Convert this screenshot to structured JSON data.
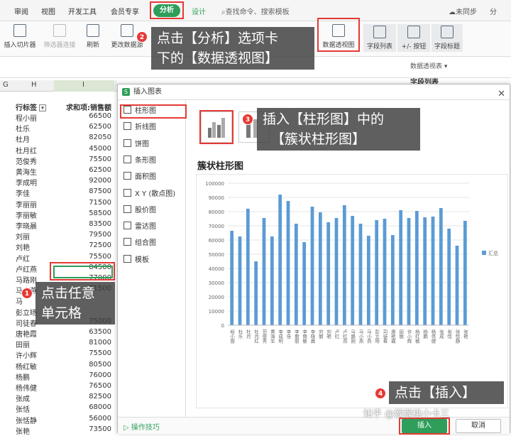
{
  "menu": {
    "tabs": [
      "审阅",
      "视图",
      "开发工具",
      "会员专享"
    ],
    "active_tab": "分析",
    "design_tab": "设计",
    "search_placeholder": "查找命令、搜索模板",
    "unsync": "未同步",
    "share": "分"
  },
  "ribbon": {
    "items": [
      {
        "label": "插入切片器",
        "icon": "slicer-icon"
      },
      {
        "label": "筛选器连接",
        "icon": "filter-connect-icon"
      },
      {
        "label": "刷新",
        "icon": "refresh-icon"
      },
      {
        "label": "更改数据源",
        "icon": "datasource-icon"
      },
      {
        "label": "数据透视图",
        "icon": "pivot-chart-icon"
      },
      {
        "label": "字段列表",
        "icon": "field-list-icon"
      },
      {
        "label": "+/- 按钮",
        "icon": "plus-minus-icon"
      },
      {
        "label": "字段标题",
        "icon": "field-header-icon"
      }
    ]
  },
  "callouts": {
    "c1": {
      "badge": "1",
      "line1": "点击任意",
      "line2": "单元格"
    },
    "c2": {
      "badge": "2",
      "line1": "点击【分析】选项卡",
      "line2": "下的【数据透视图】"
    },
    "c3": {
      "badge": "3",
      "line1": "插入【柱形图】中的",
      "line2": "【簇状柱形图】"
    },
    "c4": {
      "badge": "4",
      "line1": "点击【插入】"
    }
  },
  "right_panel": {
    "top": "数据透视表 ▾",
    "field_list": "字段列表"
  },
  "sheet": {
    "col_headers": [
      "G",
      "H",
      "I"
    ],
    "header_label": "行标签",
    "header_value": "求和项:销售额",
    "rows": [
      {
        "name": "程小丽",
        "value": "66500"
      },
      {
        "name": "杜乐",
        "value": "62500"
      },
      {
        "name": "杜月",
        "value": "82050"
      },
      {
        "name": "杜月红",
        "value": "45000"
      },
      {
        "name": "范俊秀",
        "value": "75500"
      },
      {
        "name": "黄海生",
        "value": "62500"
      },
      {
        "name": "李成明",
        "value": "92000"
      },
      {
        "name": "李佳",
        "value": "87500"
      },
      {
        "name": "李丽丽",
        "value": "71500"
      },
      {
        "name": "李丽敏",
        "value": "58500"
      },
      {
        "name": "李晓晨",
        "value": "83500"
      },
      {
        "name": "刘丽",
        "value": "79500"
      },
      {
        "name": "刘艳",
        "value": "72500"
      },
      {
        "name": "卢红",
        "value": "75500"
      },
      {
        "name": "卢红燕",
        "value": "84500"
      },
      {
        "name": "马路刚",
        "value": "77000"
      },
      {
        "name": "马小燕",
        "value": "71500"
      },
      {
        "name": "马",
        "value": ""
      },
      {
        "name": "彭立旸",
        "value": ""
      },
      {
        "name": "司徒春",
        "value": "75000"
      },
      {
        "name": "唐艳霞",
        "value": "63500"
      },
      {
        "name": "田丽",
        "value": "81000"
      },
      {
        "name": "许小辉",
        "value": "75500"
      },
      {
        "name": "杨红敏",
        "value": "80500"
      },
      {
        "name": "杨鹏",
        "value": "76000"
      },
      {
        "name": "杨伟健",
        "value": "76500"
      },
      {
        "name": "张成",
        "value": "82500"
      },
      {
        "name": "张恬",
        "value": "68000"
      },
      {
        "name": "张恬静",
        "value": "56000"
      },
      {
        "name": "张艳",
        "value": "73500"
      }
    ]
  },
  "dialog": {
    "title": "插入图表",
    "chart_types": [
      {
        "label": "柱形图",
        "icon": "column-chart-icon"
      },
      {
        "label": "折线图",
        "icon": "line-chart-icon"
      },
      {
        "label": "饼图",
        "icon": "pie-chart-icon"
      },
      {
        "label": "条形图",
        "icon": "bar-chart-icon"
      },
      {
        "label": "面积图",
        "icon": "area-chart-icon"
      },
      {
        "label": "X Y (散点图)",
        "icon": "scatter-chart-icon"
      },
      {
        "label": "股价图",
        "icon": "stock-chart-icon"
      },
      {
        "label": "雷达图",
        "icon": "radar-chart-icon"
      },
      {
        "label": "组合图",
        "icon": "combo-chart-icon"
      },
      {
        "label": "模板",
        "icon": "template-icon"
      }
    ],
    "preview_title": "簇状柱形图",
    "tips": "操作技巧",
    "insert": "插入",
    "cancel": "取消"
  },
  "watermark": "知乎 @猴猴桃小卡三",
  "chart_data": {
    "type": "bar",
    "title": "",
    "xlabel": "",
    "ylabel": "",
    "ylim": [
      0,
      100000
    ],
    "yticks": [
      0,
      10000,
      20000,
      30000,
      40000,
      50000,
      60000,
      70000,
      80000,
      90000,
      100000
    ],
    "legend": "right",
    "legend_label": "汇总",
    "color": "#5b9bd5",
    "categories": [
      "程小丽",
      "杜乐",
      "杜月",
      "杜月红",
      "范俊秀",
      "黄海生",
      "李成明",
      "李佳",
      "李丽丽",
      "李丽敏",
      "李晓晨",
      "刘丽",
      "刘艳",
      "卢红",
      "卢红燕",
      "马路刚",
      "马小燕",
      "马小燕",
      "彭立旸",
      "司徒春",
      "唐艳霞",
      "田丽",
      "许小辉",
      "杨红敏",
      "杨鹏",
      "杨伟健",
      "张成",
      "张恬",
      "张恬静",
      "张艳"
    ],
    "values": [
      66500,
      62500,
      82050,
      45000,
      75500,
      62500,
      92000,
      87500,
      71500,
      58500,
      83500,
      79500,
      72500,
      75500,
      84500,
      77000,
      71500,
      63000,
      74000,
      75000,
      63500,
      81000,
      75500,
      80500,
      76000,
      76500,
      82500,
      68000,
      56000,
      73500
    ]
  }
}
